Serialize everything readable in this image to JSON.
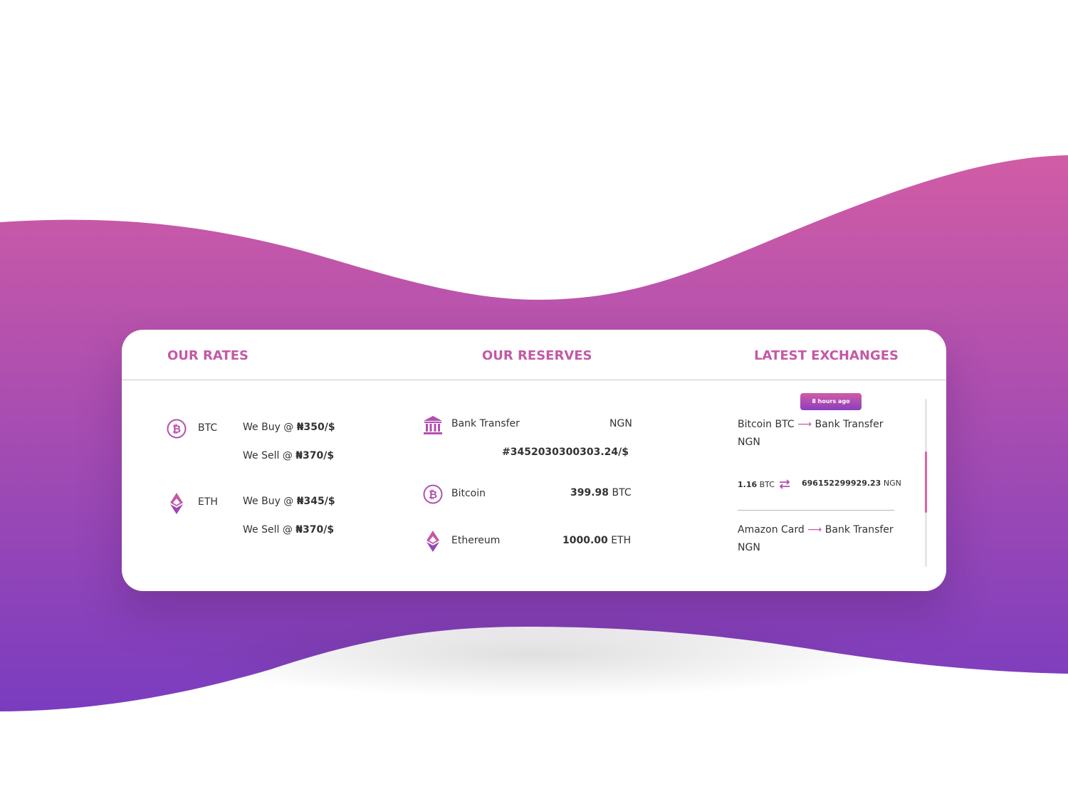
{
  "colors": {
    "accent": "#c459a6",
    "wave_top": "#d15ca5",
    "wave_bottom": "#7a3cbf",
    "scroll_thumb": "#e2609d"
  },
  "headers": {
    "rates": "OUR RATES",
    "reserves": "OUR RESERVES",
    "latest": "LATEST EXCHANGES"
  },
  "rates": [
    {
      "icon": "bitcoin-icon",
      "symbol": "BTC",
      "buy_prefix": "We Buy @ ",
      "buy_value": "₦350/$",
      "sell_prefix": "We Sell @ ",
      "sell_value": "₦370/$"
    },
    {
      "icon": "ethereum-icon",
      "symbol": "ETH",
      "buy_prefix": "We Buy @ ",
      "buy_value": "₦345/$",
      "sell_prefix": "We Sell @ ",
      "sell_value": "₦370/$"
    }
  ],
  "reserves": [
    {
      "icon": "bank-icon",
      "name": "Bank Transfer",
      "currency": "NGN",
      "amount": "#3452030300303.24/$"
    },
    {
      "icon": "bitcoin-icon",
      "name": "Bitcoin",
      "amount": "399.98",
      "unit": " BTC"
    },
    {
      "icon": "ethereum-icon",
      "name": "Ethereum",
      "amount": "1000.00",
      "unit": " ETH"
    }
  ],
  "latest": {
    "time_badge": "8 hours ago",
    "items": [
      {
        "from": "Bitcoin BTC ",
        "arrow": "⟶",
        "to": " Bank Transfer NGN",
        "send_amount": "1.16",
        "send_unit": " BTC",
        "receive_amount": "696152299929.23",
        "receive_unit": " NGN"
      },
      {
        "from": "Amazon Card ",
        "arrow": "⟶",
        "to": " Bank Transfer NGN"
      }
    ]
  }
}
